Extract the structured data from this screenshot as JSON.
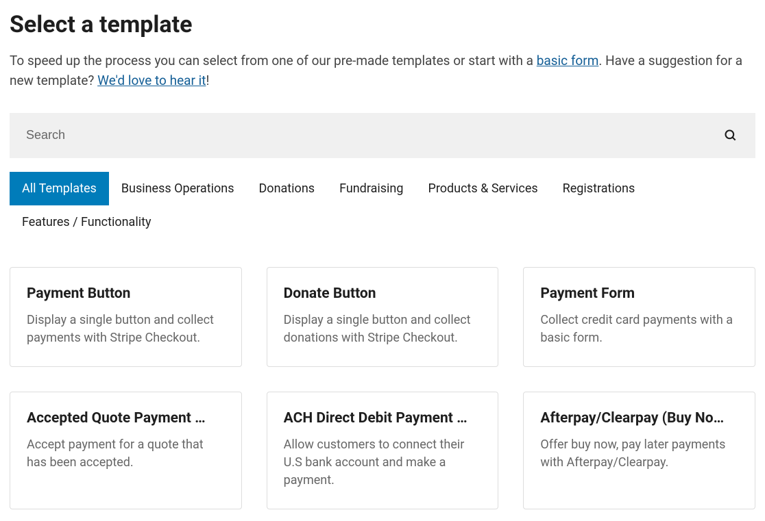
{
  "title": "Select a template",
  "intro": {
    "part1": "To speed up the process you can select from one of our pre-made templates or start with a ",
    "link1": "basic form",
    "part2": ". Have a suggestion for a new template? ",
    "link2": "We'd love to hear it",
    "part3": "!"
  },
  "search": {
    "placeholder": "Search"
  },
  "tabs": [
    {
      "label": "All Templates",
      "active": true
    },
    {
      "label": "Business Operations",
      "active": false
    },
    {
      "label": "Donations",
      "active": false
    },
    {
      "label": "Fundraising",
      "active": false
    },
    {
      "label": "Products & Services",
      "active": false
    },
    {
      "label": "Registrations",
      "active": false
    },
    {
      "label": "Features / Functionality",
      "active": false
    }
  ],
  "cards": [
    {
      "title": "Payment Button",
      "desc": "Display a single button and collect payments with Stripe Checkout."
    },
    {
      "title": "Donate Button",
      "desc": "Display a single button and collect donations with Stripe Checkout."
    },
    {
      "title": "Payment Form",
      "desc": "Collect credit card payments with a basic form."
    },
    {
      "title": "Accepted Quote Payment …",
      "desc": "Accept payment for a quote that has been accepted."
    },
    {
      "title": "ACH Direct Debit Payment …",
      "desc": "Allow customers to connect their U.S bank account and make a payment."
    },
    {
      "title": "Afterpay/Clearpay (Buy No…",
      "desc": "Offer buy now, pay later payments with Afterpay/Clearpay."
    }
  ]
}
